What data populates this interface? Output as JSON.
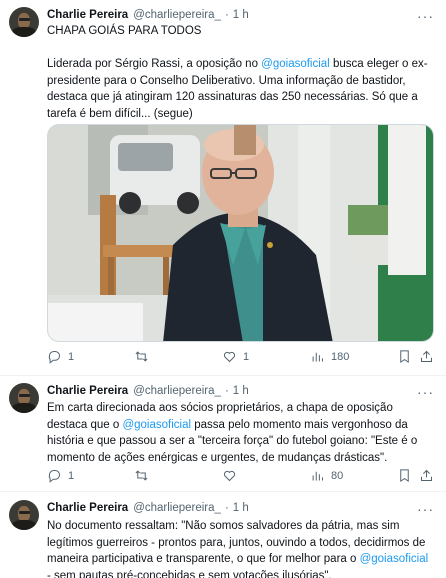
{
  "tweets": [
    {
      "author": "Charlie Pereira",
      "handle": "@charliepereira_",
      "separator": "·",
      "time": "1 h",
      "title_line": "CHAPA GOIÁS PARA TODOS",
      "text_before": "Liderada por Sérgio Rassi, a oposição no ",
      "mention": "@goiasoficial",
      "text_after": " busca eleger o ex-presidente para o Conselho Deliberativo. Uma informação de bastidor, destaca que já atingiram 120 assinaturas das 250 necessárias. Só que a tarefa é bem difícil... (segue)",
      "replies": "1",
      "retweets": "",
      "likes": "1",
      "views": "180"
    },
    {
      "author": "Charlie Pereira",
      "handle": "@charliepereira_",
      "separator": "·",
      "time": "1 h",
      "text_before": "Em carta direcionada aos sócios proprietários, a chapa de oposição destaca que o ",
      "mention": "@goiasoficial",
      "text_after": " passa pelo momento mais vergonhoso da história e que passou a ser a \"terceira força\" do futebol goiano: \"Este é o momento de ações enérgicas e urgentes, de mudanças drásticas\".",
      "replies": "1",
      "retweets": "",
      "likes": "",
      "views": "80"
    },
    {
      "author": "Charlie Pereira",
      "handle": "@charliepereira_",
      "separator": "·",
      "time": "1 h",
      "text_before": "No documento ressaltam: \"Não somos salvadores da pátria, mas sim legítimos guerreiros - prontos para, juntos, ouvindo a todos, decidirmos de maneira participativa e transparente, o que for melhor para o ",
      "mention": "@goiasoficial",
      "text_after": " - sem pautas pré-concebidas e sem votações ilusórias\"."
    }
  ],
  "colors": {
    "link": "#1d9bf0",
    "muted": "#536471",
    "text": "#0f1419"
  },
  "icons": [
    "reply-icon",
    "retweet-icon",
    "like-icon",
    "views-icon",
    "bookmark-icon",
    "share-icon",
    "more-icon"
  ]
}
